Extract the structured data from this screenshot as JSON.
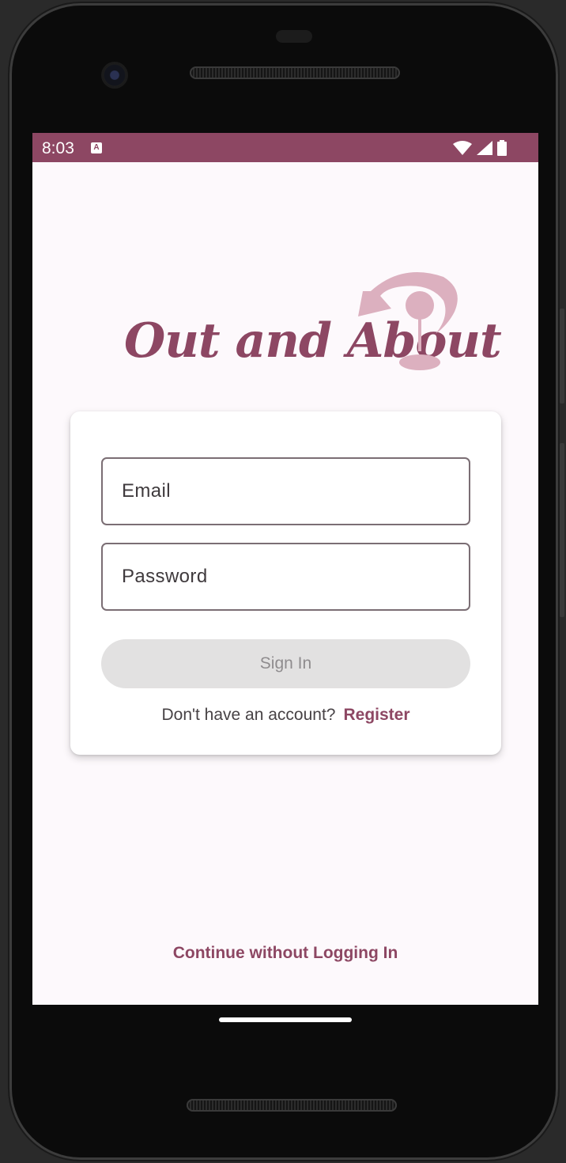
{
  "status_bar": {
    "time": "8:03",
    "notification_icon": "A",
    "icons": [
      "wifi-icon",
      "signal-icon",
      "battery-icon"
    ]
  },
  "logo": {
    "text": "Out and About",
    "icon": "wine-glass-icon",
    "colors": {
      "text": "#8d4763",
      "icon": "#dcb0bf"
    }
  },
  "login_form": {
    "email_label": "Email",
    "password_label": "Password",
    "sign_in_label": "Sign In",
    "register_prompt": "Don't have an account?",
    "register_link": "Register"
  },
  "continue_label": "Continue without Logging In",
  "colors": {
    "brand": "#8d4763",
    "background": "#fdf9fc",
    "disabled_button": "#e2e1e1"
  }
}
